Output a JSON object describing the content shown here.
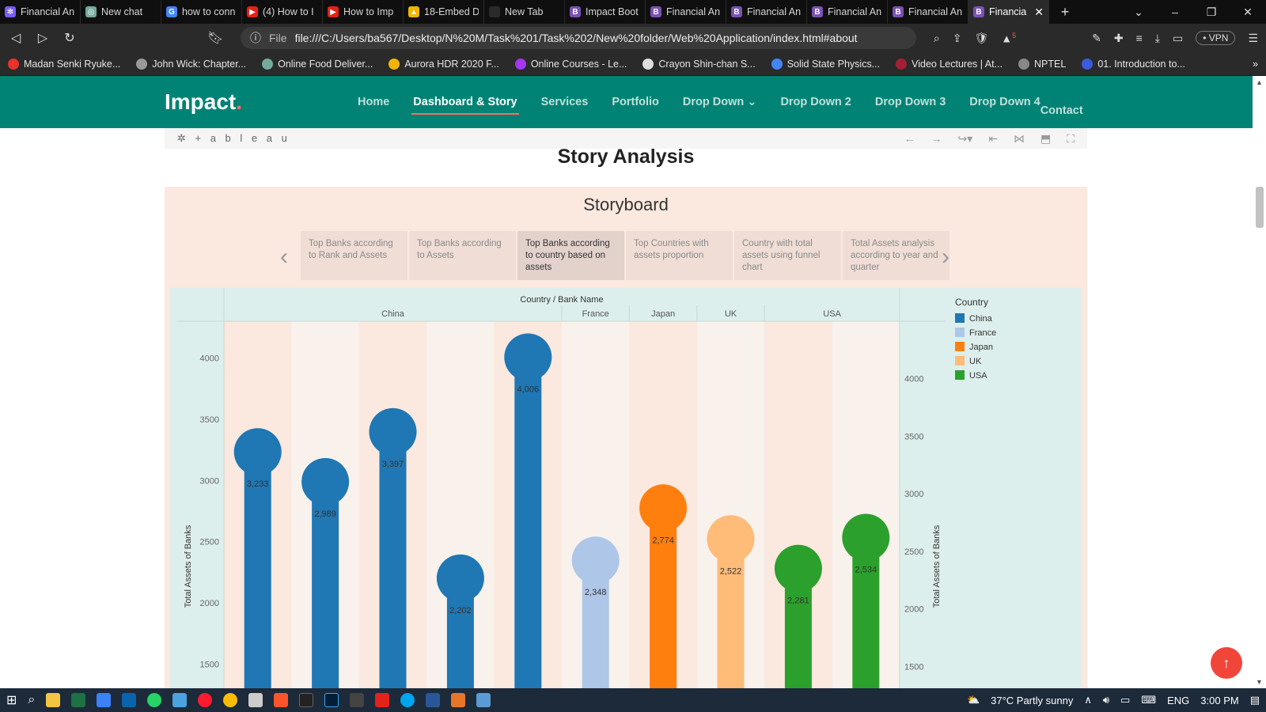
{
  "browser": {
    "tabs": [
      {
        "label": "Financial An",
        "color": "#7a5cff",
        "glyph": "✻"
      },
      {
        "label": "New chat",
        "color": "#74aa9c",
        "glyph": "◎"
      },
      {
        "label": "how to conn",
        "color": "#4285f4",
        "glyph": "G"
      },
      {
        "label": "(4) How to I",
        "color": "#e62117",
        "glyph": "▶"
      },
      {
        "label": "How to Imp",
        "color": "#e62117",
        "glyph": "▶"
      },
      {
        "label": "18-Embed D",
        "color": "#f4b400",
        "glyph": "▲"
      },
      {
        "label": "New Tab",
        "color": "#2a2a2a",
        "glyph": ""
      },
      {
        "label": "Impact Boot",
        "color": "#7952b3",
        "glyph": "B"
      },
      {
        "label": "Financial An",
        "color": "#7952b3",
        "glyph": "B"
      },
      {
        "label": "Financial An",
        "color": "#7952b3",
        "glyph": "B"
      },
      {
        "label": "Financial An",
        "color": "#7952b3",
        "glyph": "B"
      },
      {
        "label": "Financial An",
        "color": "#7952b3",
        "glyph": "B"
      },
      {
        "label": "Financia",
        "color": "#7952b3",
        "glyph": "B",
        "active": true
      }
    ],
    "url_scheme": "File",
    "url": "file:///C:/Users/ba567/Desktop/N%20M/Task%201/Task%202/New%20folder/Web%20Application/index.html#about",
    "vpn_label": "• VPN",
    "brave_badge": "5",
    "bookmarks": [
      {
        "label": "Madan Senki Ryuke...",
        "color": "#e8322a"
      },
      {
        "label": "John Wick: Chapter...",
        "color": "#999"
      },
      {
        "label": "Online Food Deliver...",
        "color": "#74aa9c"
      },
      {
        "label": "Aurora HDR 2020 F...",
        "color": "#f4b400"
      },
      {
        "label": "Online Courses - Le...",
        "color": "#a435f0"
      },
      {
        "label": "Crayon Shin-chan S...",
        "color": "#ddd"
      },
      {
        "label": "Solid State Physics...",
        "color": "#4285f4"
      },
      {
        "label": "Video Lectures | At...",
        "color": "#a31f34"
      },
      {
        "label": "NPTEL",
        "color": "#888"
      },
      {
        "label": "01. Introduction to...",
        "color": "#3b5bdb"
      }
    ]
  },
  "site": {
    "logo": "Impact",
    "logo_dot": ".",
    "nav": [
      "Home",
      "Dashboard & Story",
      "Services",
      "Portfolio",
      "Drop Down",
      "Drop Down 2",
      "Drop Down 3",
      "Drop Down 4",
      "Contact"
    ],
    "active_nav": "Dashboard & Story",
    "tableau_logo": "+ a b l e a u",
    "section_title": "Story Analysis",
    "storyboard_title": "Storyboard",
    "story_points": [
      "Top Banks according to Rank and Assets",
      "Top Banks according to Assets",
      "Top Banks according to country based on assets",
      "Top Countries with assets proportion",
      "Country with total assets using funnel chart",
      "Total Assets analysis according to year and quarter"
    ],
    "selected_story_point": 2
  },
  "chart_data": {
    "type": "bar",
    "title": "Country / Bank Name",
    "ylabel": "Total Assets of Banks",
    "ylim": [
      1200,
      4300
    ],
    "yticks": [
      1500,
      2000,
      2500,
      3000,
      3500,
      4000
    ],
    "right_ylim": [
      1200,
      4500
    ],
    "right_yticks": [
      1500,
      2000,
      2500,
      3000,
      3500,
      4000
    ],
    "groups": [
      {
        "name": "China",
        "values": [
          3233,
          2989,
          3397,
          2202,
          4006
        ]
      },
      {
        "name": "France",
        "values": [
          2348
        ]
      },
      {
        "name": "Japan",
        "values": [
          2774
        ]
      },
      {
        "name": "UK",
        "values": [
          2522
        ]
      },
      {
        "name": "USA",
        "values": [
          2281,
          2534
        ]
      }
    ],
    "value_labels": [
      "3,233",
      "2,989",
      "3,397",
      "2,202",
      "4,006",
      "2,348",
      "2,774",
      "2,522",
      "2,281",
      "2,534"
    ],
    "legend_title": "Country",
    "legend": [
      {
        "name": "China",
        "color": "#1f77b4"
      },
      {
        "name": "France",
        "color": "#aec7e8"
      },
      {
        "name": "Japan",
        "color": "#ff7f0e"
      },
      {
        "name": "UK",
        "color": "#ffbb78"
      },
      {
        "name": "USA",
        "color": "#2ca02c"
      }
    ],
    "legend_placement": "right"
  },
  "taskbar": {
    "weather": "37°C  Partly sunny",
    "lang": "ENG",
    "time": "3:00 PM"
  }
}
